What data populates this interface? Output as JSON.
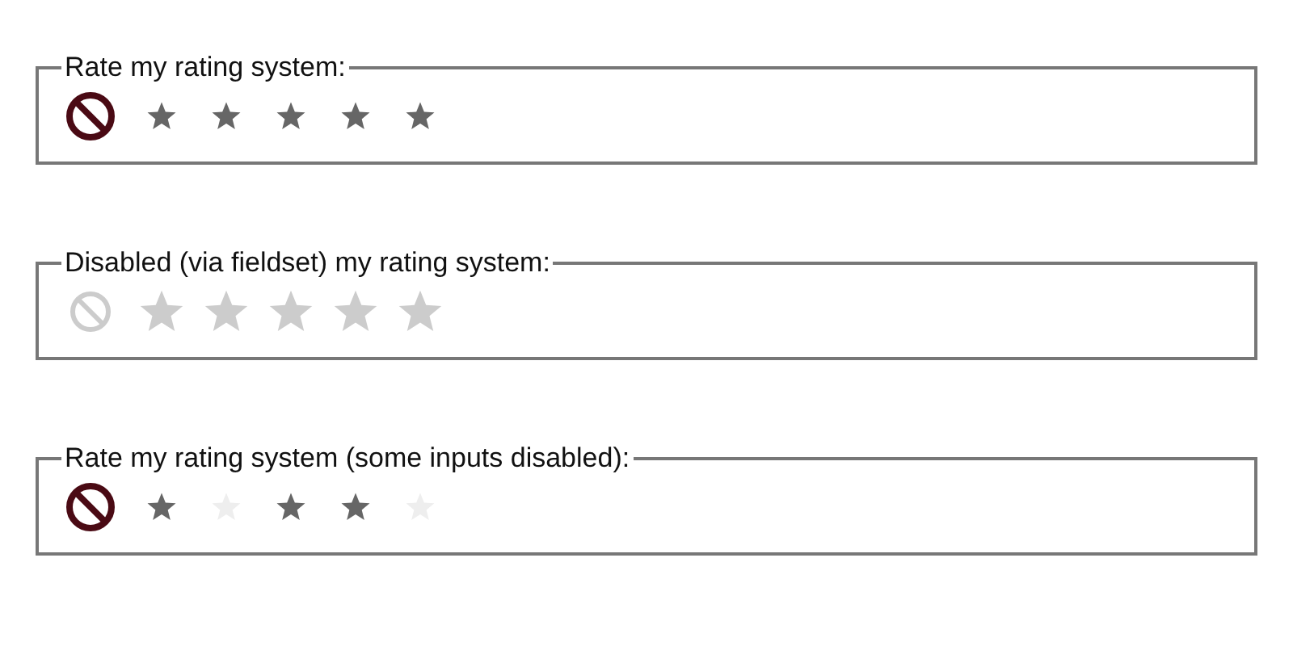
{
  "fieldsets": [
    {
      "legend": "Rate my rating system:",
      "disabled": false,
      "clear_button": {
        "disabled": false
      },
      "options": [
        {
          "disabled": false
        },
        {
          "disabled": false
        },
        {
          "disabled": false
        },
        {
          "disabled": false
        },
        {
          "disabled": false
        }
      ]
    },
    {
      "legend": "Disabled (via fieldset) my rating system:",
      "disabled": true,
      "clear_button": {
        "disabled": true
      },
      "options": [
        {
          "disabled": true
        },
        {
          "disabled": true
        },
        {
          "disabled": true
        },
        {
          "disabled": true
        },
        {
          "disabled": true
        }
      ]
    },
    {
      "legend": "Rate my rating system (some inputs disabled):",
      "disabled": false,
      "clear_button": {
        "disabled": false
      },
      "options": [
        {
          "disabled": false
        },
        {
          "disabled": true
        },
        {
          "disabled": false
        },
        {
          "disabled": false
        },
        {
          "disabled": true
        }
      ]
    }
  ]
}
